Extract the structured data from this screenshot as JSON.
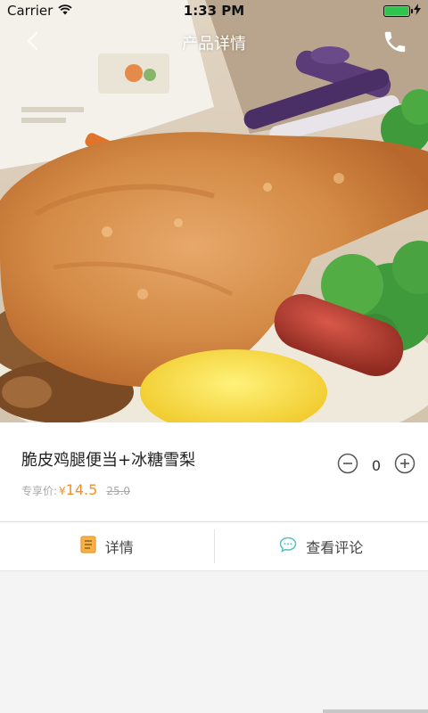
{
  "status_bar": {
    "carrier": "Carrier",
    "time": "1:33 PM",
    "battery_level": 1.0,
    "battery_color": "#2ec44d",
    "icons": [
      "wifi-icon",
      "battery-icon",
      "charging-bolt-icon"
    ]
  },
  "nav": {
    "title": "产品详情",
    "back_icon": "chevron-left-icon",
    "phone_icon": "phone-icon"
  },
  "product": {
    "name": "脆皮鸡腿便当+冰糖雪梨",
    "price_label": "专享价:",
    "currency": "¥",
    "price": "14.5",
    "original_price": "25.0",
    "quantity": "0",
    "accent_color": "#f0902c"
  },
  "tabs": [
    {
      "label": "详情",
      "icon": "document-icon",
      "icon_color": "#f0a030"
    },
    {
      "label": "查看评论",
      "icon": "comment-icon",
      "icon_color": "#5bc0c0"
    }
  ]
}
